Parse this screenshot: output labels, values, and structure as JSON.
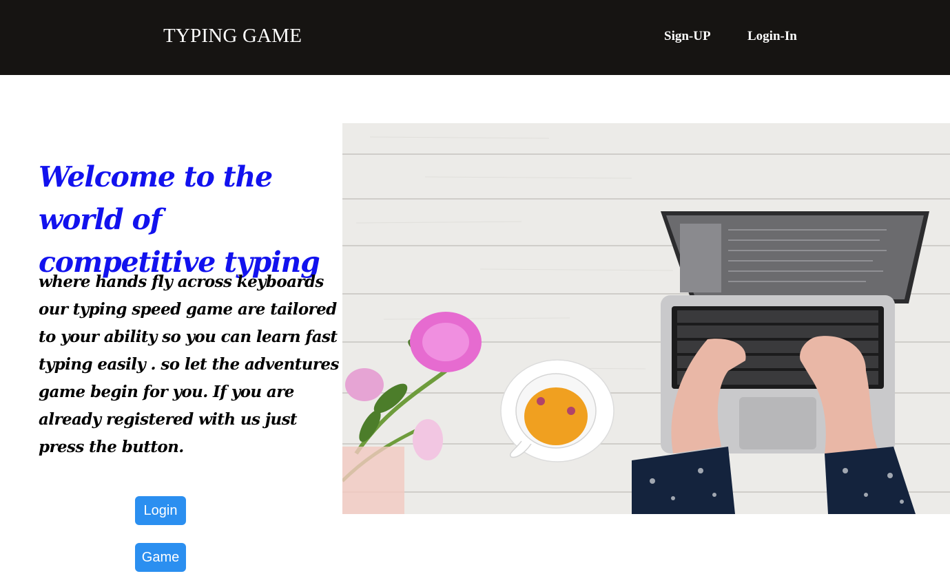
{
  "header": {
    "brand": "TYPING GAME",
    "nav": [
      {
        "label": "Sign-UP"
      },
      {
        "label": "Login-In"
      }
    ]
  },
  "hero": {
    "heading": "Welcome to the world of competitive typing",
    "body": "where hands fly across keyboards our typing speed game are tailored to your ability so you can learn fast typing easily . so let the adventures game begin for you. If you are already registered with us just press the button."
  },
  "buttons": {
    "login": "Login",
    "game": "Game"
  },
  "colors": {
    "header_bg": "#161412",
    "heading": "#1212ee",
    "button": "#2b8ff0"
  },
  "image": {
    "subject": "laptop-typing-photo"
  }
}
